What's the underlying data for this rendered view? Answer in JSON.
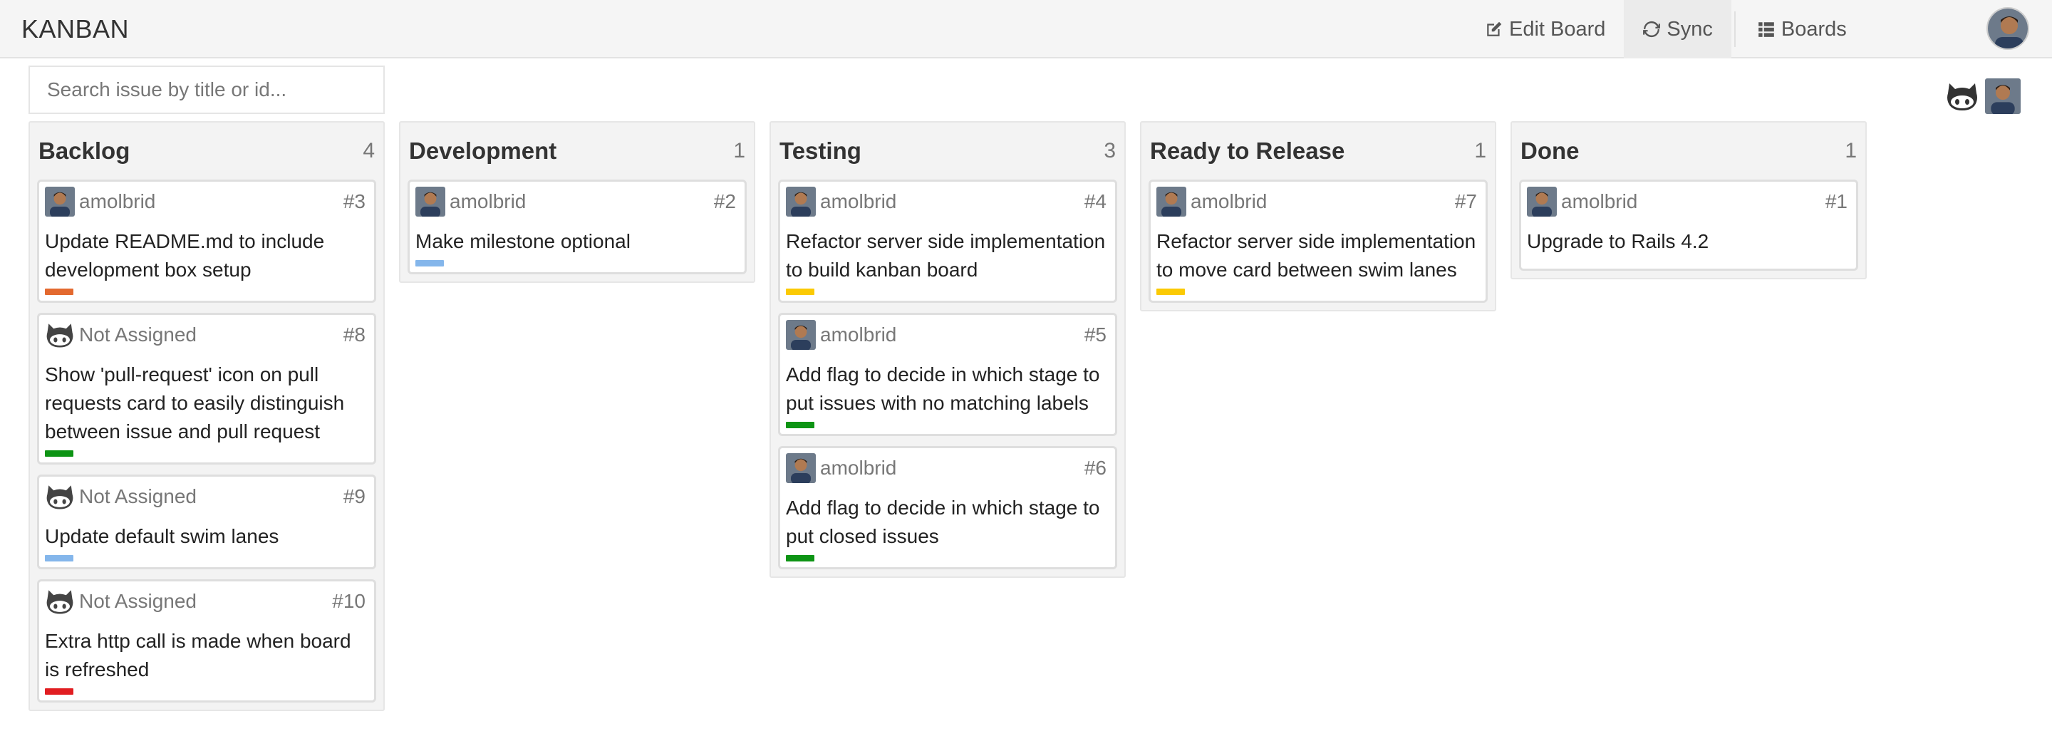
{
  "app": {
    "brand": "KANBAN"
  },
  "nav": {
    "edit_board": "Edit Board",
    "sync": "Sync",
    "boards": "Boards"
  },
  "search": {
    "placeholder": "Search issue by title or id..."
  },
  "colors": {
    "orange": "#e3692f",
    "green": "#0d9414",
    "blue": "#84b6eb",
    "yellow": "#fbca04",
    "red": "#e11d21"
  },
  "columns": [
    {
      "title": "Backlog",
      "count": "4",
      "cards": [
        {
          "user": "amolbrid",
          "avatar": "user-photo",
          "number": "#3",
          "title": "Update README.md to include development box setup",
          "label_color": "#e3692f"
        },
        {
          "user": "Not Assigned",
          "avatar": "github-octocat-icon",
          "number": "#8",
          "title": "Show 'pull-request' icon on pull requests card to easily distinguish between issue and pull request",
          "label_color": "#0d9414"
        },
        {
          "user": "Not Assigned",
          "avatar": "github-octocat-icon",
          "number": "#9",
          "title": "Update default swim lanes",
          "label_color": "#84b6eb"
        },
        {
          "user": "Not Assigned",
          "avatar": "github-octocat-icon",
          "number": "#10",
          "title": "Extra http call is made when board is refreshed",
          "label_color": "#e11d21"
        }
      ]
    },
    {
      "title": "Development",
      "count": "1",
      "cards": [
        {
          "user": "amolbrid",
          "avatar": "user-photo",
          "number": "#2",
          "title": "Make milestone optional",
          "label_color": "#84b6eb"
        }
      ]
    },
    {
      "title": "Testing",
      "count": "3",
      "cards": [
        {
          "user": "amolbrid",
          "avatar": "user-photo",
          "number": "#4",
          "title": "Refactor server side implementation to build kanban board",
          "label_color": "#fbca04"
        },
        {
          "user": "amolbrid",
          "avatar": "user-photo",
          "number": "#5",
          "title": "Add flag to decide in which stage to put issues with no matching labels",
          "label_color": "#0d9414"
        },
        {
          "user": "amolbrid",
          "avatar": "user-photo",
          "number": "#6",
          "title": "Add flag to decide in which stage to put closed issues",
          "label_color": "#0d9414"
        }
      ]
    },
    {
      "title": "Ready to Release",
      "count": "1",
      "cards": [
        {
          "user": "amolbrid",
          "avatar": "user-photo",
          "number": "#7",
          "title": "Refactor server side implementation to move card between swim lanes",
          "label_color": "#fbca04"
        }
      ]
    },
    {
      "title": "Done",
      "count": "1",
      "cards": [
        {
          "user": "amolbrid",
          "avatar": "user-photo",
          "number": "#1",
          "title": "Upgrade to Rails 4.2",
          "label_color": null
        }
      ]
    }
  ]
}
